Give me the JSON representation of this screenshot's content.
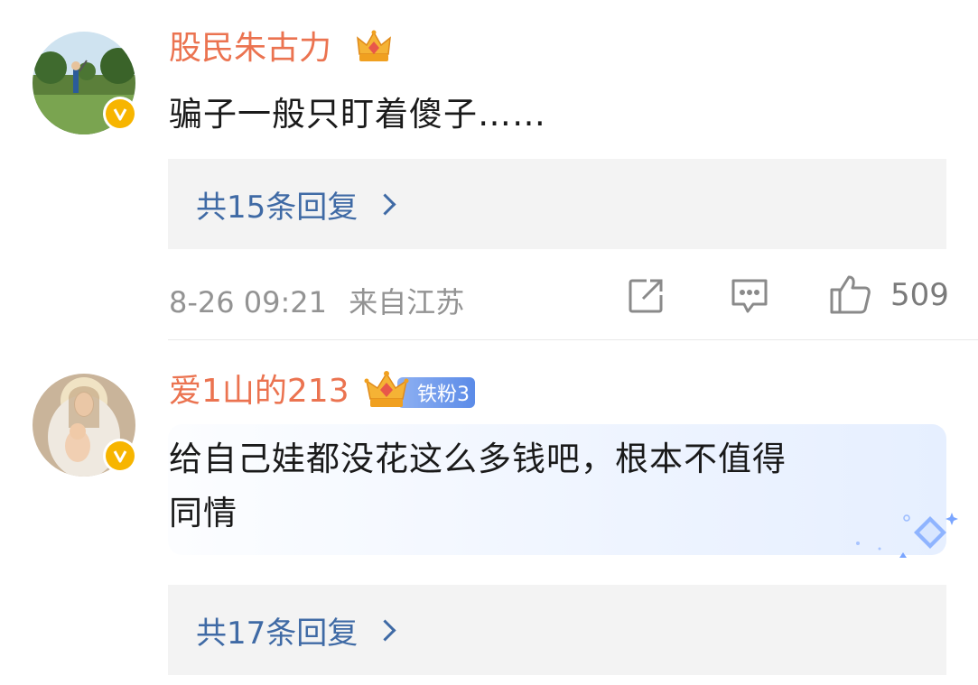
{
  "comments": [
    {
      "username": "股民朱古力",
      "text": "骗子一般只盯着傻子……",
      "replies_label": "共15条回复",
      "date": "8-26 09:21",
      "location": "来自江苏",
      "likes": "509"
    },
    {
      "username": "爱1山的213",
      "fan_badge": "铁粉3",
      "text_line1": "给自己娃都没花这么多钱吧，根本不值得",
      "text_line2": "同情",
      "replies_label": "共17条回复"
    }
  ],
  "colors": {
    "username": "#eb7350",
    "link": "#3f6aa5",
    "meta": "#939393",
    "reply_bg": "#f3f3f3",
    "verified": "#f7b500"
  },
  "icons": [
    "crown-icon",
    "verified-icon",
    "repost-icon",
    "comment-icon",
    "like-icon",
    "chevron-right-icon",
    "diamond-icon"
  ]
}
